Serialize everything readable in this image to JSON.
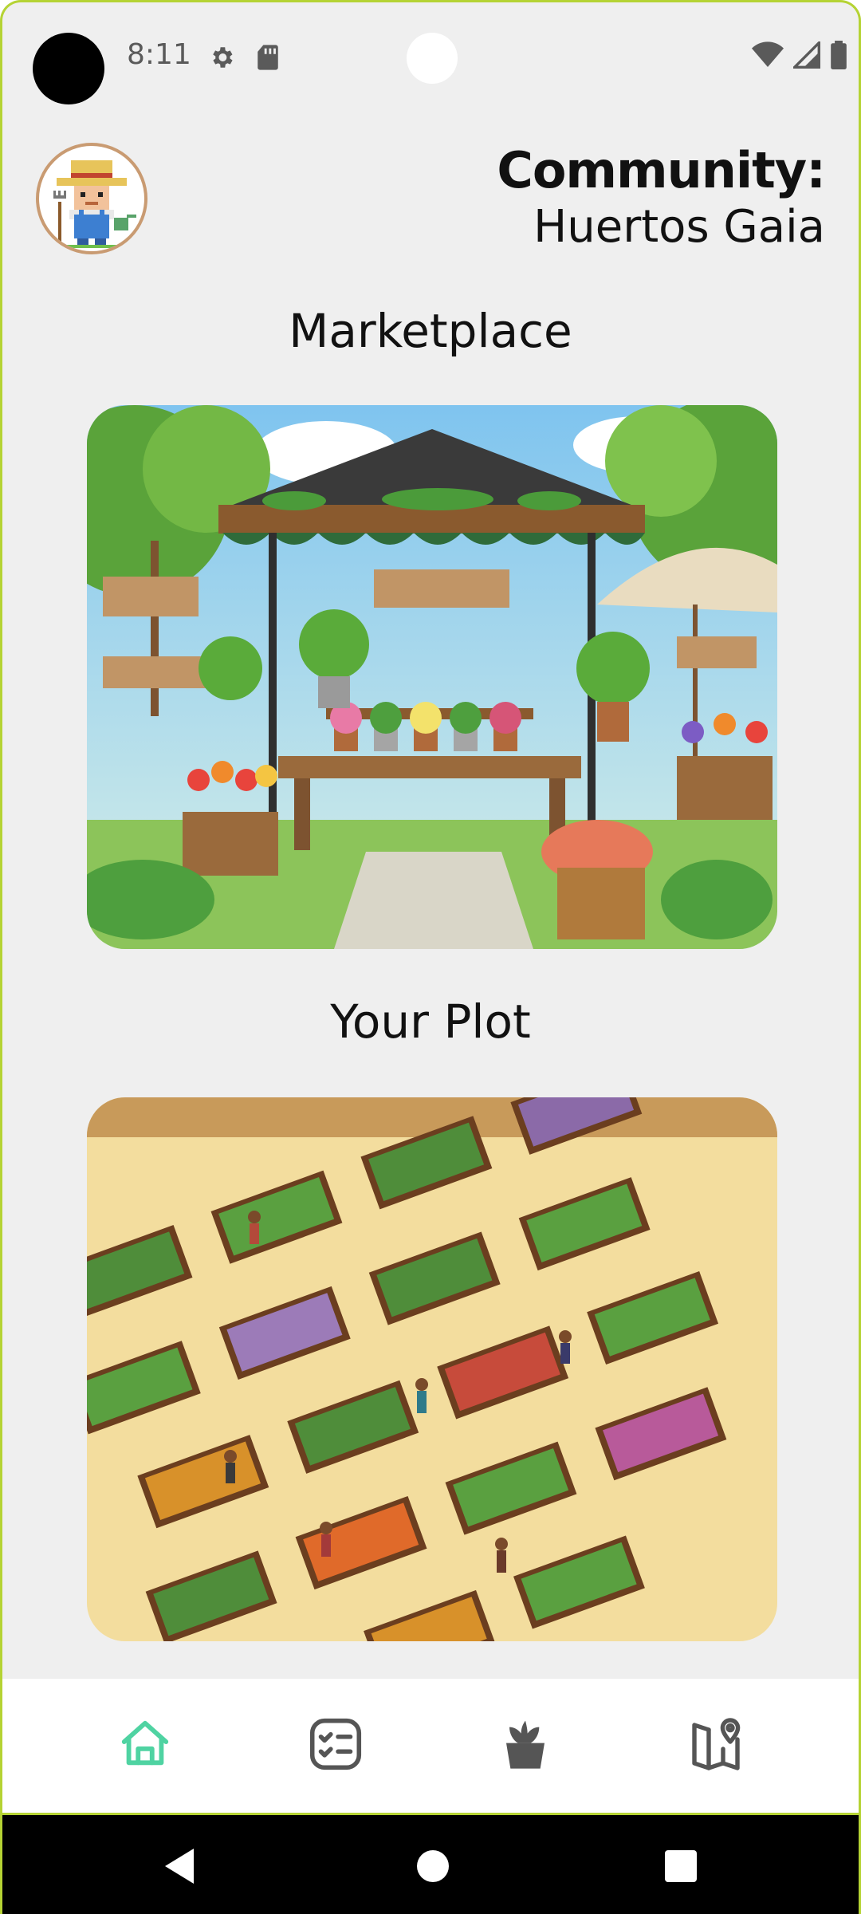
{
  "status_bar": {
    "time": "8:11",
    "icons": [
      "settings-icon",
      "sd-card-icon",
      "wifi-icon",
      "signal-icon",
      "battery-icon"
    ]
  },
  "header": {
    "community_label": "Community:",
    "community_name": "Huertos Gaia"
  },
  "sections": {
    "marketplace_title": "Marketplace",
    "plot_title": "Your Plot"
  },
  "bottom_nav": {
    "items": [
      {
        "icon": "home-icon",
        "active": true
      },
      {
        "icon": "checklist-icon",
        "active": false
      },
      {
        "icon": "potted-plant-icon",
        "active": false
      },
      {
        "icon": "map-pin-icon",
        "active": false
      }
    ],
    "active_color": "#4fd3a2",
    "inactive_color": "#555555"
  },
  "colors": {
    "accent_border": "#b5d334",
    "background": "#efefef"
  }
}
